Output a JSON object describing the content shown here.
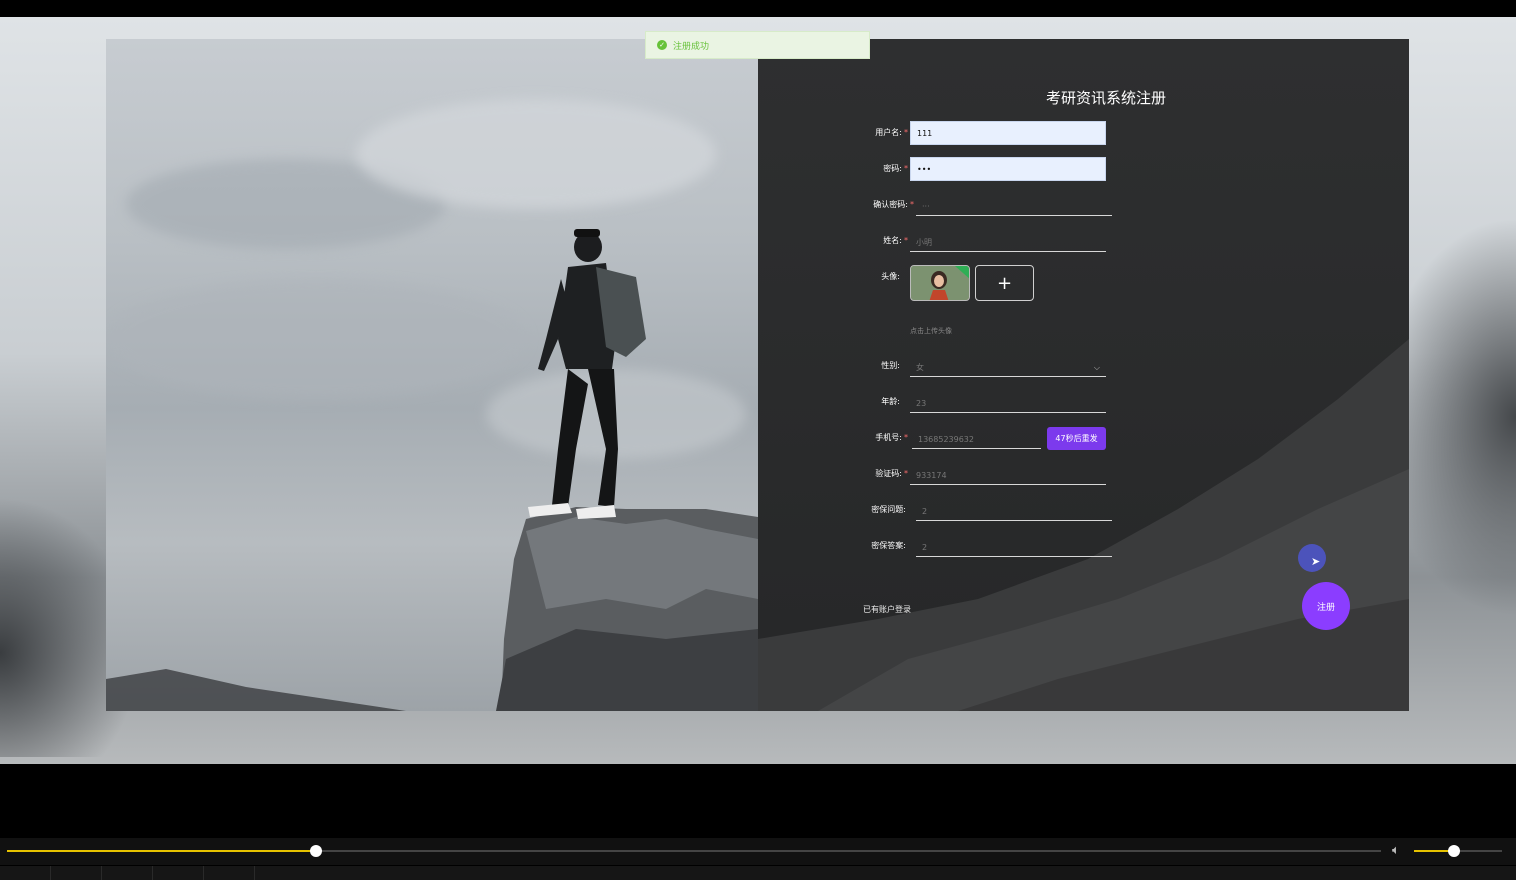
{
  "toast": {
    "text": "注册成功",
    "icon": "check-circle-icon",
    "color": "#67c23a"
  },
  "form": {
    "title": "考研资讯系统注册",
    "username": {
      "label": "用户名:",
      "value": "111",
      "required": true
    },
    "password": {
      "label": "密码:",
      "value": "•••",
      "required": true
    },
    "confirm_password": {
      "label": "确认密码:",
      "placeholder": "···",
      "required": true
    },
    "name": {
      "label": "姓名:",
      "placeholder": "小明",
      "required": true
    },
    "avatar": {
      "label": "头像:",
      "add_symbol": "+",
      "hint": "点击上传头像"
    },
    "gender": {
      "label": "性别:",
      "value": "女"
    },
    "age": {
      "label": "年龄:",
      "placeholder": "23"
    },
    "phone": {
      "label": "手机号:",
      "placeholder": "13685239632",
      "required": true,
      "send_button": "47秒后重发"
    },
    "code": {
      "label": "验证码:",
      "placeholder": "933174",
      "required": true
    },
    "security_question": {
      "label": "密保问题:",
      "placeholder": "2"
    },
    "security_answer": {
      "label": "密保答案:",
      "placeholder": "2"
    },
    "login_link": "已有账户登录",
    "submit": "注册",
    "accent": "#7c3aed"
  },
  "player": {
    "progress": 0.225,
    "volume": 0.45,
    "accent": "#e6c200",
    "volume_icon": "speaker-icon"
  }
}
